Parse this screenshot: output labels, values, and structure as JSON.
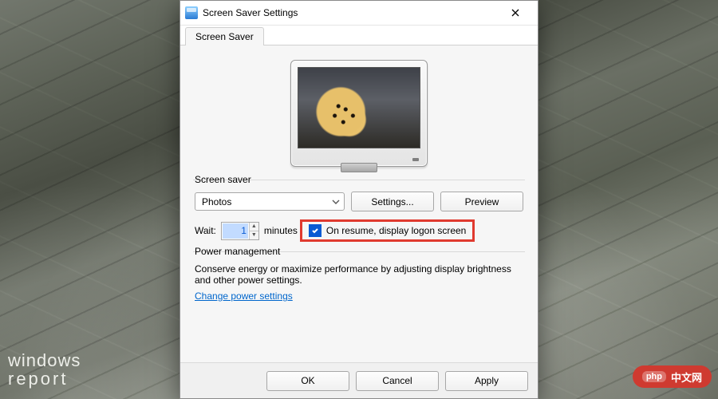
{
  "window": {
    "title": "Screen Saver Settings",
    "tab": "Screen Saver"
  },
  "screensaver": {
    "group_label": "Screen saver",
    "selected": "Photos",
    "settings_btn": "Settings...",
    "preview_btn": "Preview",
    "wait_label": "Wait:",
    "wait_value": "1",
    "wait_unit": "minutes",
    "resume_checked": true,
    "resume_label": "On resume, display logon screen"
  },
  "power": {
    "group_label": "Power management",
    "description": "Conserve energy or maximize performance by adjusting display brightness and other power settings.",
    "link": "Change power settings"
  },
  "footer": {
    "ok": "OK",
    "cancel": "Cancel",
    "apply": "Apply"
  },
  "watermark": {
    "left_line1": "windows",
    "left_line2": "report",
    "right_badge": "php",
    "right_text": "中文网"
  }
}
